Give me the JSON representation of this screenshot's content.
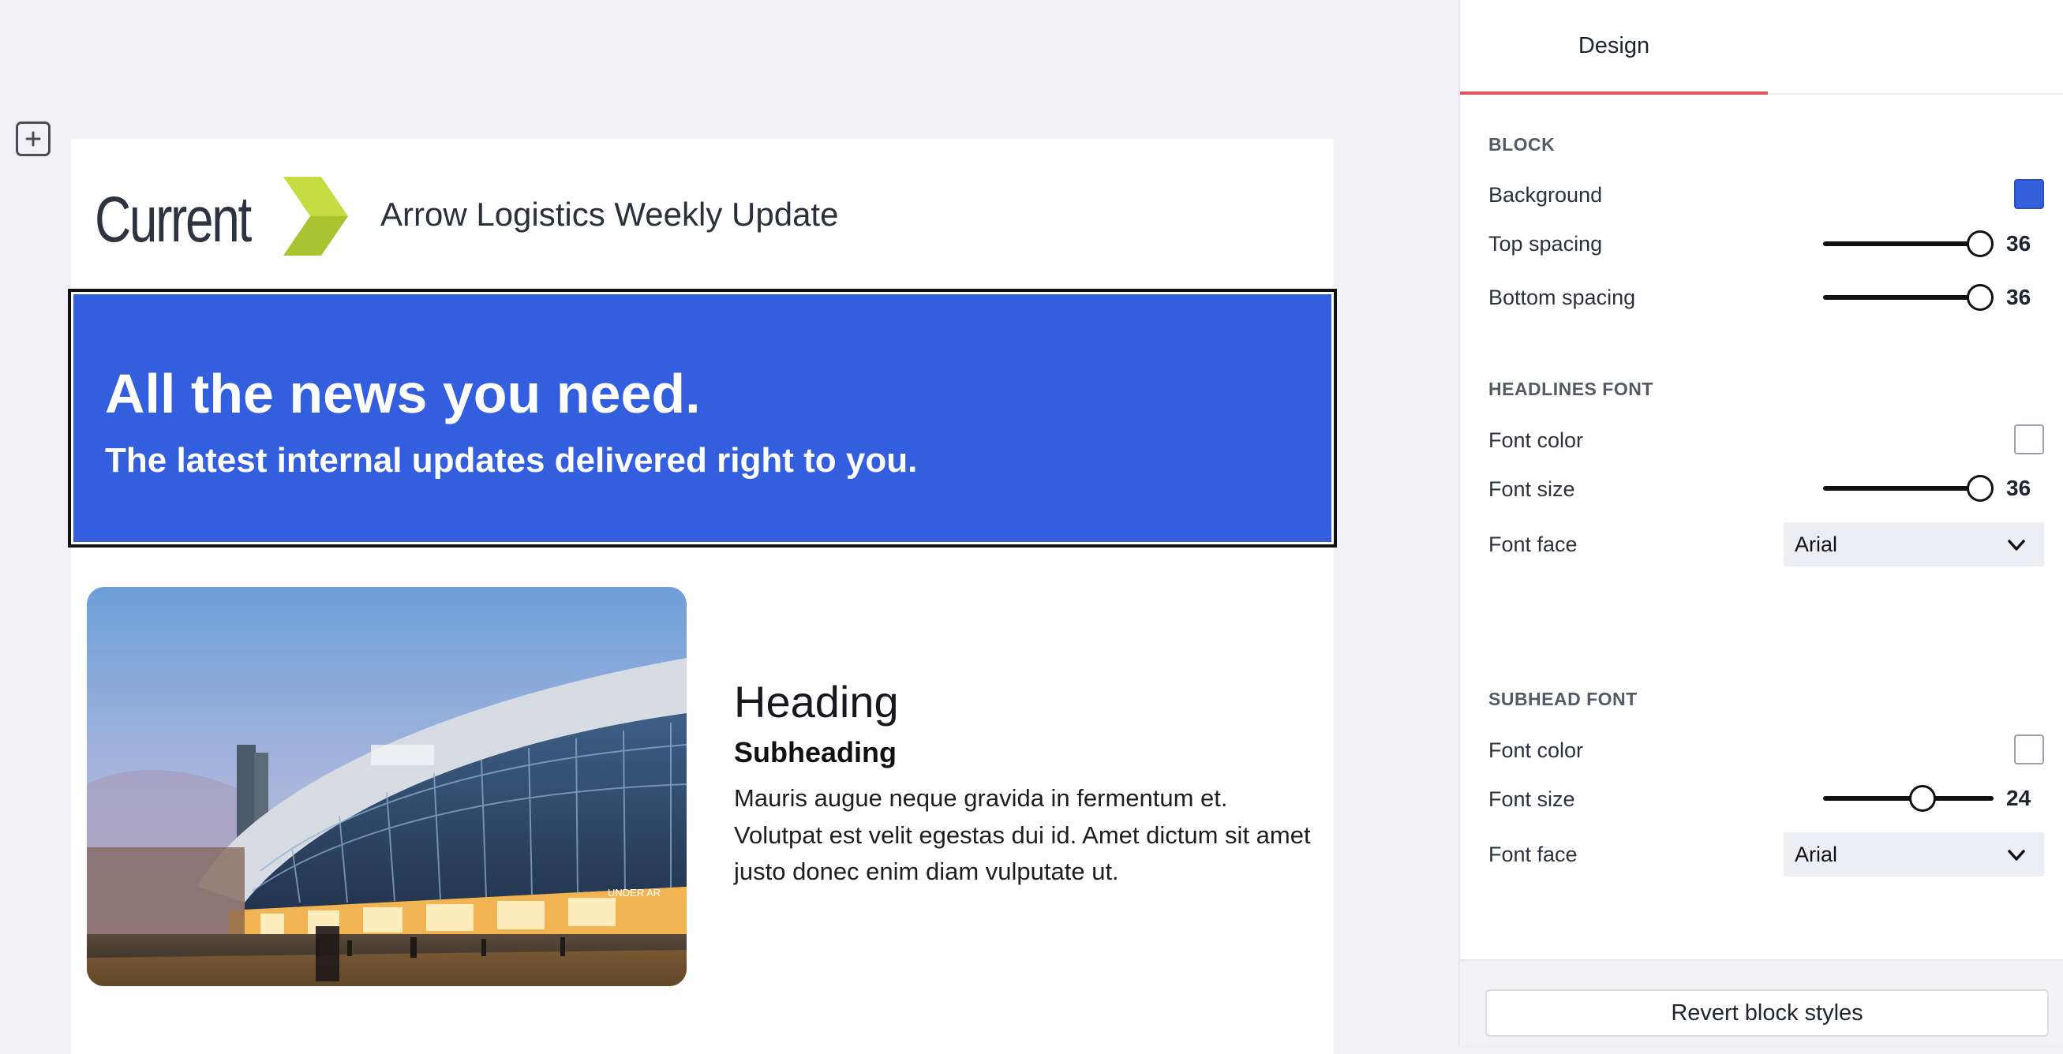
{
  "colors": {
    "accent_tab": "#e05656",
    "hero_background": "#335fde",
    "logo_green": "#b7d433"
  },
  "canvas": {
    "add_block_icon": "plus-square-icon"
  },
  "email": {
    "logo_text": "Current",
    "logo_icon": "chevron-mark-icon",
    "title": "Arrow Logistics Weekly Update",
    "hero": {
      "headline": "All the news you need.",
      "subhead": "The latest internal updates delivered right to you."
    },
    "card": {
      "image_icon": "building-photo",
      "image_sign": "UNDER AR",
      "heading": "Heading",
      "subheading": "Subheading",
      "body": "Mauris augue neque gravida in fermentum et. Volutpat est velit egestas dui id. Amet dictum sit amet justo donec enim diam vulputate ut."
    }
  },
  "panel": {
    "tab_label": "Design",
    "block": {
      "title": "BLOCK",
      "background_label": "Background",
      "background_color": "#3460de",
      "top_spacing_label": "Top spacing",
      "top_spacing_value": "36",
      "top_spacing_fraction": 1.0,
      "bottom_spacing_label": "Bottom spacing",
      "bottom_spacing_value": "36",
      "bottom_spacing_fraction": 1.0
    },
    "headlines_font": {
      "title": "HEADLINES FONT",
      "font_color_label": "Font color",
      "font_color": "#ffffff",
      "font_size_label": "Font size",
      "font_size_value": "36",
      "font_size_fraction": 1.0,
      "font_face_label": "Font face",
      "font_face_value": "Arial"
    },
    "subhead_font": {
      "title": "SUBHEAD FONT",
      "font_color_label": "Font color",
      "font_color": "#ffffff",
      "font_size_label": "Font size",
      "font_size_value": "24",
      "font_size_fraction": 0.6,
      "font_face_label": "Font face",
      "font_face_value": "Arial"
    },
    "revert_label": "Revert block styles"
  }
}
